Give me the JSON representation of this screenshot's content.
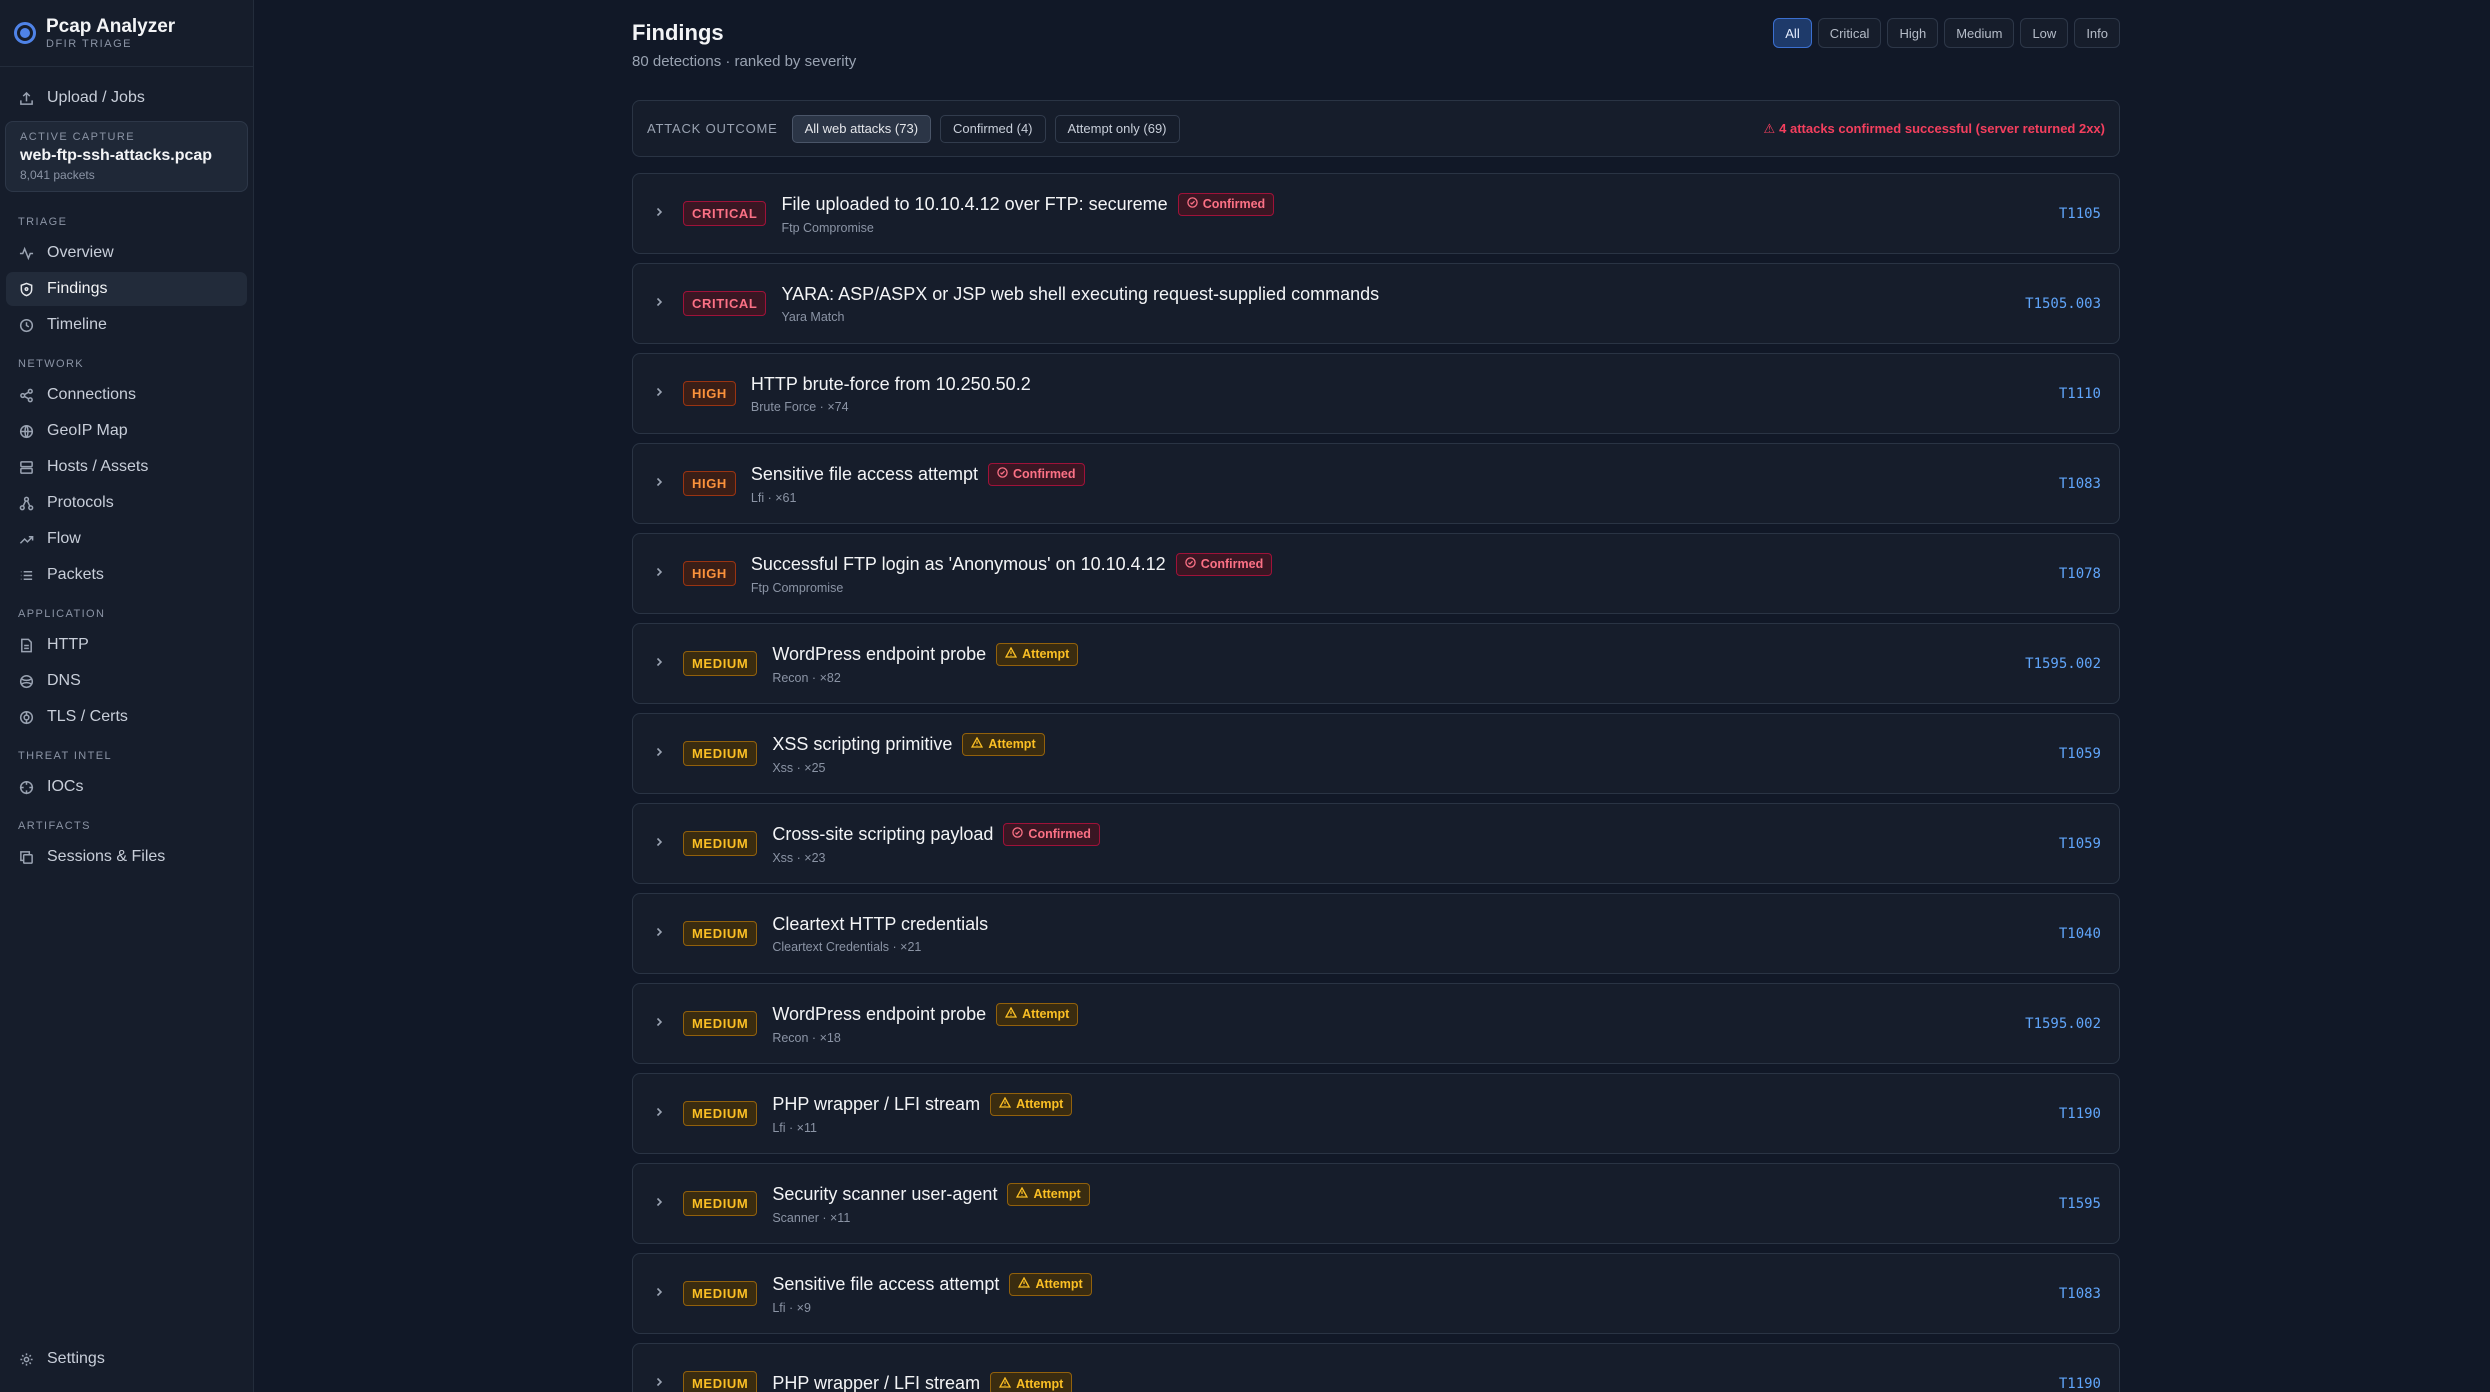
{
  "app": {
    "name": "Pcap Analyzer",
    "subtitle": "DFIR TRIAGE"
  },
  "sidebar": {
    "upload": {
      "label": "Upload / Jobs",
      "icon": "upload-icon"
    },
    "capture": {
      "label": "ACTIVE CAPTURE",
      "name": "web-ftp-ssh-attacks.pcap",
      "packets": "8,041 packets"
    },
    "sections": {
      "triage": "TRIAGE",
      "network": "NETWORK",
      "application": "APPLICATION",
      "threat_intel": "THREAT INTEL",
      "artifacts": "ARTIFACTS"
    },
    "items": {
      "overview": "Overview",
      "findings": "Findings",
      "timeline": "Timeline",
      "connections": "Connections",
      "geoip": "GeoIP Map",
      "hosts": "Hosts / Assets",
      "protocols": "Protocols",
      "flow": "Flow",
      "packets": "Packets",
      "http": "HTTP",
      "dns": "DNS",
      "tls": "TLS / Certs",
      "iocs": "IOCs",
      "sessions": "Sessions & Files",
      "settings": "Settings"
    }
  },
  "header": {
    "title": "Findings",
    "subtitle": "80 detections · ranked by severity",
    "severity_filters": [
      "All",
      "Critical",
      "High",
      "Medium",
      "Low",
      "Info"
    ],
    "active_filter": "All"
  },
  "outcome": {
    "label": "ATTACK OUTCOME",
    "buttons": [
      "All web attacks (73)",
      "Confirmed (4)",
      "Attempt only (69)"
    ],
    "alert": "4 attacks confirmed successful (server returned 2xx)"
  },
  "colors": {
    "accent": "#4f83e8",
    "critical": "#fb7185",
    "high": "#fb923c",
    "medium": "#fbbf24",
    "technique": "#60a5fa"
  },
  "findings": [
    {
      "severity": "CRITICAL",
      "title": "File uploaded to 10.10.4.12 over FTP: secureme",
      "tag": "Confirmed",
      "sub": "Ftp Compromise",
      "technique": "T1105"
    },
    {
      "severity": "CRITICAL",
      "title": "YARA: ASP/ASPX or JSP web shell executing request-supplied commands",
      "tag": "",
      "sub": "Yara Match",
      "technique": "T1505.003"
    },
    {
      "severity": "HIGH",
      "title": "HTTP brute-force from 10.250.50.2",
      "tag": "",
      "sub": "Brute Force · ×74",
      "technique": "T1110"
    },
    {
      "severity": "HIGH",
      "title": "Sensitive file access attempt",
      "tag": "Confirmed",
      "sub": "Lfi · ×61",
      "technique": "T1083"
    },
    {
      "severity": "HIGH",
      "title": "Successful FTP login as 'Anonymous' on 10.10.4.12",
      "tag": "Confirmed",
      "sub": "Ftp Compromise",
      "technique": "T1078"
    },
    {
      "severity": "MEDIUM",
      "title": "WordPress endpoint probe",
      "tag": "Attempt",
      "sub": "Recon · ×82",
      "technique": "T1595.002"
    },
    {
      "severity": "MEDIUM",
      "title": "XSS scripting primitive",
      "tag": "Attempt",
      "sub": "Xss · ×25",
      "technique": "T1059"
    },
    {
      "severity": "MEDIUM",
      "title": "Cross-site scripting payload",
      "tag": "Confirmed",
      "sub": "Xss · ×23",
      "technique": "T1059"
    },
    {
      "severity": "MEDIUM",
      "title": "Cleartext HTTP credentials",
      "tag": "",
      "sub": "Cleartext Credentials · ×21",
      "technique": "T1040"
    },
    {
      "severity": "MEDIUM",
      "title": "WordPress endpoint probe",
      "tag": "Attempt",
      "sub": "Recon · ×18",
      "technique": "T1595.002"
    },
    {
      "severity": "MEDIUM",
      "title": "PHP wrapper / LFI stream",
      "tag": "Attempt",
      "sub": "Lfi · ×11",
      "technique": "T1190"
    },
    {
      "severity": "MEDIUM",
      "title": "Security scanner user-agent",
      "tag": "Attempt",
      "sub": "Scanner · ×11",
      "technique": "T1595"
    },
    {
      "severity": "MEDIUM",
      "title": "Sensitive file access attempt",
      "tag": "Attempt",
      "sub": "Lfi · ×9",
      "technique": "T1083"
    },
    {
      "severity": "MEDIUM",
      "title": "PHP wrapper / LFI stream",
      "tag": "Attempt",
      "sub": "",
      "technique": "T1190"
    }
  ]
}
